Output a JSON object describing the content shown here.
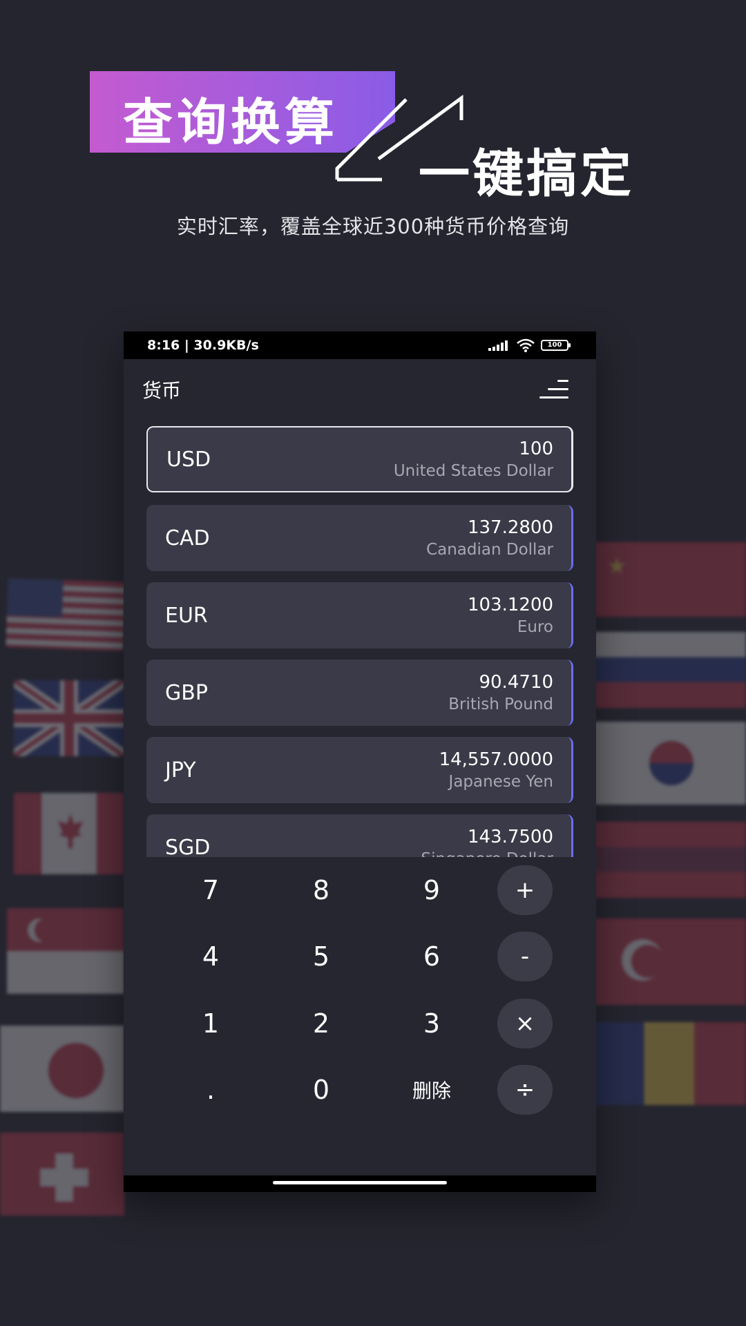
{
  "promo": {
    "headline": "查询换算",
    "subheadline": "一键搞定",
    "tagline": "实时汇率，覆盖全球近300种货币价格查询"
  },
  "status_bar": {
    "time_speed": "8:16 | 30.9KB/s",
    "battery": "100"
  },
  "app_bar": {
    "title": "货币",
    "menu_icon": "menu-icon"
  },
  "currencies": [
    {
      "code": "USD",
      "amount": "100",
      "name": "United States Dollar",
      "selected": true
    },
    {
      "code": "CAD",
      "amount": "137.2800",
      "name": "Canadian Dollar"
    },
    {
      "code": "EUR",
      "amount": "103.1200",
      "name": "Euro"
    },
    {
      "code": "GBP",
      "amount": "90.4710",
      "name": "British Pound"
    },
    {
      "code": "JPY",
      "amount": "14,557.0000",
      "name": "Japanese Yen"
    },
    {
      "code": "SGD",
      "amount": "143.7500",
      "name": "Singapore Dollar"
    }
  ],
  "keypad": {
    "k7": "7",
    "k8": "8",
    "k9": "9",
    "plus": "+",
    "k4": "4",
    "k5": "5",
    "k6": "6",
    "minus": "-",
    "k1": "1",
    "k2": "2",
    "k3": "3",
    "times": "×",
    "dot": ".",
    "k0": "0",
    "delete": "删除",
    "divide": "÷"
  },
  "colors": {
    "background": "#25252f",
    "card": "#3a3a48",
    "accent": "#6a6ef2",
    "gradient_start": "#c45bd0",
    "gradient_end": "#8a5ce6"
  }
}
